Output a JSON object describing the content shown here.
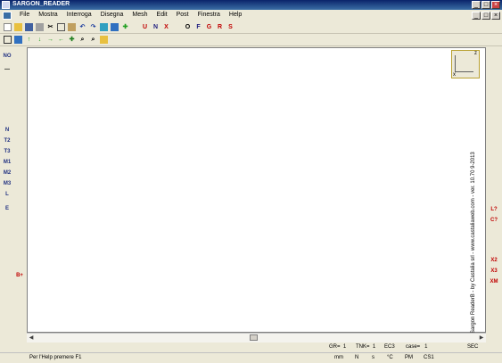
{
  "window": {
    "title": "SARGON_READER"
  },
  "menu": [
    "File",
    "Mostra",
    "Interroga",
    "Disegna",
    "Mesh",
    "Edit",
    "Post",
    "Finestra",
    "Help"
  ],
  "toolbar1": [
    "U",
    "N",
    "X",
    "O",
    "F",
    "G",
    "R",
    "S"
  ],
  "left_tools": [
    "NO",
    "N",
    "T2",
    "T3",
    "M1",
    "M2",
    "M3",
    "L",
    "E",
    "B+"
  ],
  "right_tools": [
    "L?",
    "C?",
    "X2",
    "X3",
    "XM"
  ],
  "canvas": {
    "axis_x": "x",
    "axis_z": "z",
    "vertical_text": "Sargon ReaderB - by Castalia srl - www.castaliaweb.com - ver. 10.70 9-2013"
  },
  "info": {
    "gr": "GR=  1",
    "tnk": "TNK=  1",
    "ec": "EC3",
    "case": "case=   1",
    "sec": "SEC"
  },
  "status": {
    "help": "Per l'Help premere F1",
    "units": [
      "mm",
      "N",
      "s",
      "°C",
      "PM",
      "CS1"
    ]
  }
}
